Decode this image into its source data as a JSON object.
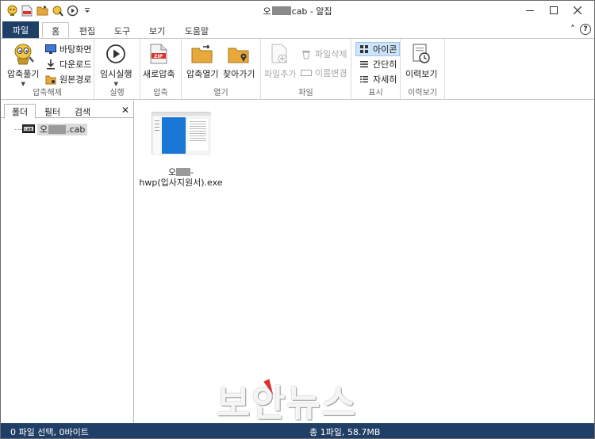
{
  "titlebar": {
    "title_prefix": "오",
    "title_suffix": "cab - 알집",
    "qat_icons": [
      "alzip-logo-icon",
      "zip-icon",
      "folder-open-icon",
      "extract-icon",
      "play-icon",
      "dropdown-icon"
    ],
    "window_controls": [
      "minimize-icon",
      "maximize-icon",
      "close-icon"
    ]
  },
  "tabs": {
    "file": "파일",
    "home": "홈",
    "edit": "편집",
    "tools": "도구",
    "view": "보기",
    "help": "도움말",
    "collapse_glyph": "˄",
    "help_glyph": "?"
  },
  "ribbon": {
    "extract_group": {
      "label": "압축해제",
      "extract": "압축풀기",
      "desktop": "바탕화면",
      "downloads": "다운로드",
      "original_path": "원본경로"
    },
    "run_group": {
      "label": "실행",
      "temp_run": "임시실행"
    },
    "compress_group": {
      "label": "압축",
      "new_compress": "새로압축"
    },
    "open_group": {
      "label": "열기",
      "open_archive": "압축열기",
      "find": "찾아가기"
    },
    "file_group": {
      "label": "파일",
      "add_file": "파일추가",
      "delete_file": "파일삭제",
      "rename": "이름변경"
    },
    "display_group": {
      "label": "표시",
      "icon": "아이콘",
      "brief": "간단히",
      "detail": "자세히"
    },
    "history_group": {
      "label": "이력보기",
      "history": "이력보기"
    }
  },
  "leftpanel": {
    "tabs": [
      "폴더",
      "필터",
      "검색"
    ],
    "close_glyph": "✕",
    "tree": {
      "prefix": "오",
      "suffix": ".cab"
    }
  },
  "main": {
    "file": {
      "line1_prefix": "오",
      "line1_suffix": "-",
      "line2": "hwp(입사지원서).exe"
    }
  },
  "statusbar": {
    "left": "0 파일 선택,  0바이트",
    "right": "총 1파일,  58.7MB"
  },
  "watermark": "보안뉴스",
  "colors": {
    "accent": "#1f3f66",
    "selected": "#cde3f7",
    "disabled": "#a8a8a8"
  }
}
